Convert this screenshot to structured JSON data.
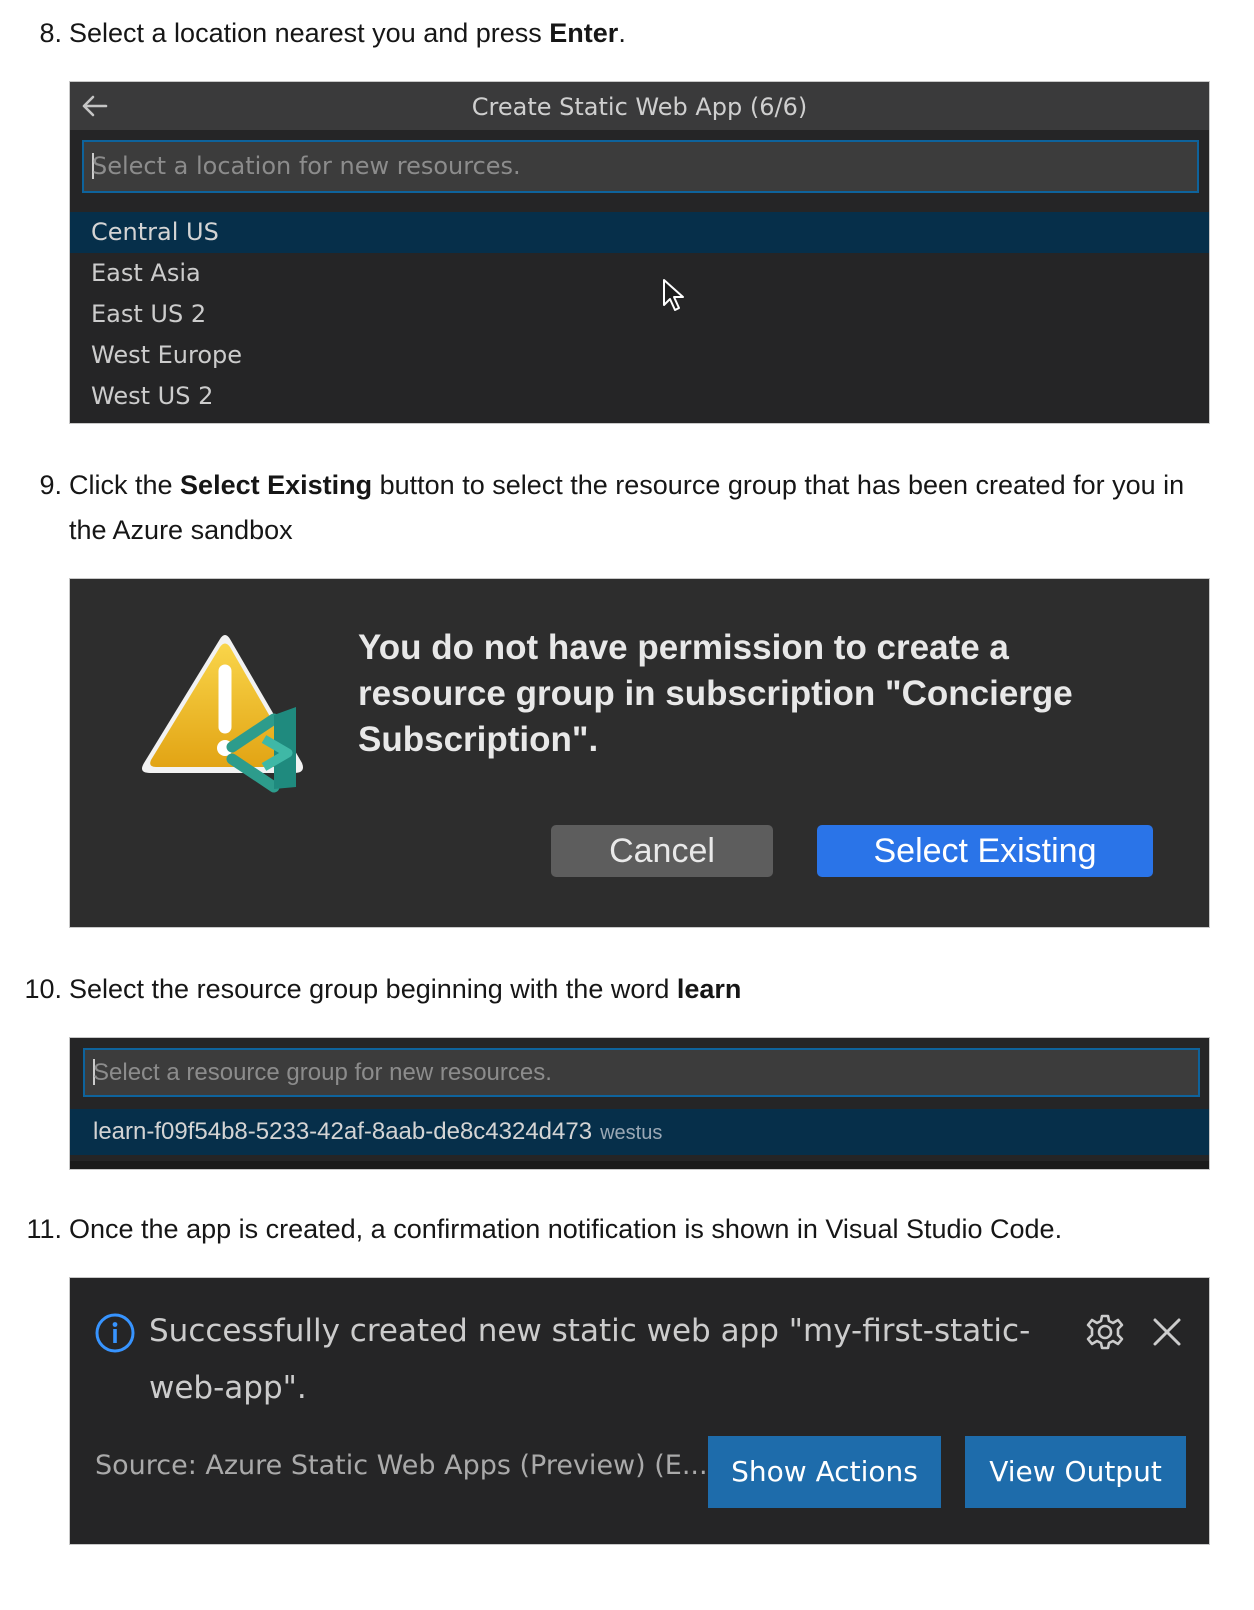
{
  "steps": [
    {
      "num": "8.",
      "pre": "Select a location nearest you and press ",
      "bold": "Enter",
      "post": "."
    },
    {
      "num": "9.",
      "pre": "Click the ",
      "bold": "Select Existing",
      "post": " button to select the resource group that has been created for you in the Azure sandbox"
    },
    {
      "num": "10.",
      "pre": "Select the resource group beginning with the word ",
      "bold": "learn",
      "post": ""
    },
    {
      "num": "11.",
      "pre": "Once the app is created, a confirmation notification is shown in Visual Studio Code.",
      "bold": "",
      "post": ""
    }
  ],
  "quickpick_location": {
    "title": "Create Static Web App (6/6)",
    "placeholder": "Select a location for new resources.",
    "items": [
      "Central US",
      "East Asia",
      "East US 2",
      "West Europe",
      "West US 2"
    ],
    "selected_index": 0
  },
  "dialog": {
    "message": "You do not have permission to create a resource group in subscription \"Concierge Subscription\".",
    "cancel_label": "Cancel",
    "select_existing_label": "Select Existing"
  },
  "quickpick_group": {
    "placeholder": "Select a resource group for new resources.",
    "item_label": "learn-f09f54b8-5233-42af-8aab-de8c4324d473",
    "item_description": "westus"
  },
  "notification": {
    "message": "Successfully created new static web app \"my-first-static-web-app\".",
    "source": "Source: Azure Static Web Apps (Preview) (E...",
    "show_actions_label": "Show Actions",
    "view_output_label": "View Output"
  },
  "icons": {
    "back": "arrow-left-icon",
    "cursor": "mouse-pointer-icon",
    "warning": "warning-vscode-icon",
    "info": "info-circle-icon",
    "gear": "gear-icon",
    "close": "close-icon"
  },
  "colors": {
    "selected_button": "#2a74e8",
    "notification_button": "#1e6cab",
    "list_selection": "#062f4a",
    "input_focus_border": "#0e639c"
  }
}
